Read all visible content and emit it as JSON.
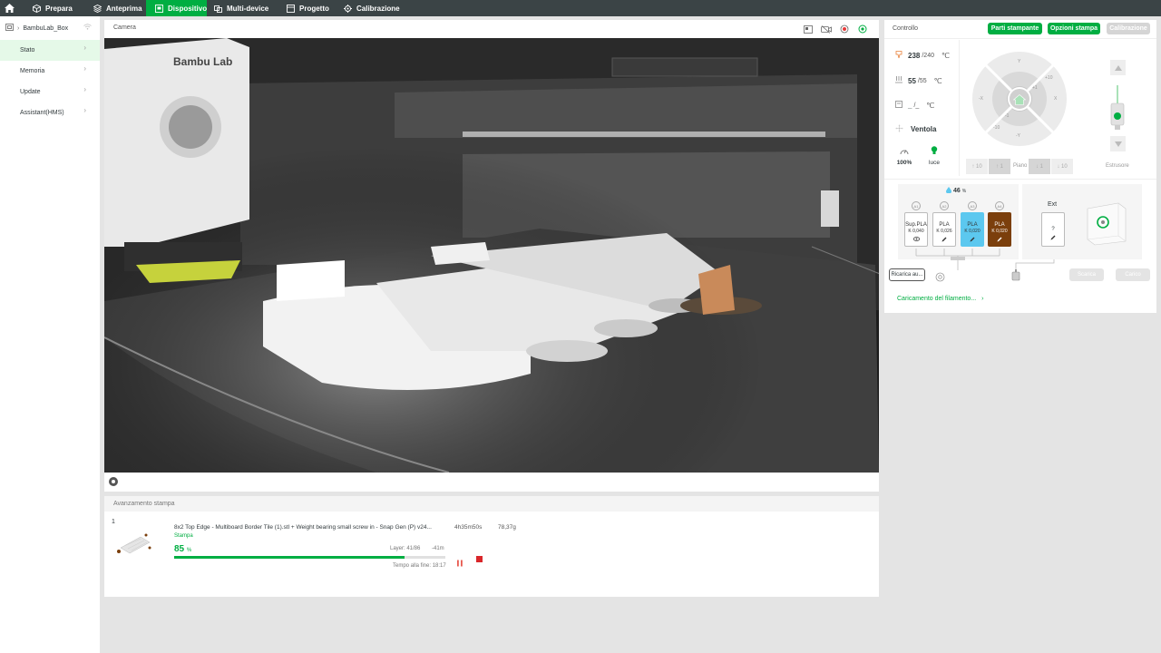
{
  "nav": {
    "tabs": [
      {
        "label": "Prepara",
        "icon": "cube-icon"
      },
      {
        "label": "Anteprima",
        "icon": "layers-icon"
      },
      {
        "label": "Dispositivo",
        "icon": "device-icon"
      },
      {
        "label": "Multi-device",
        "icon": "multi-device-icon"
      },
      {
        "label": "Progetto",
        "icon": "project-icon"
      },
      {
        "label": "Calibrazione",
        "icon": "calibration-icon"
      }
    ],
    "active": "Dispositivo"
  },
  "sidebar": {
    "device_name": "BambuLab_Box",
    "items": [
      {
        "label": "Stato"
      },
      {
        "label": "Memoria"
      },
      {
        "label": "Update"
      },
      {
        "label": "Assistant(HMS)"
      }
    ]
  },
  "camera": {
    "title": "Camera"
  },
  "progress": {
    "title": "Avanzamento stampa",
    "plate_number": "1",
    "file_name": "8x2 Top Edge - Multiboard Border Tile (1).stl + Weight bearing small screw in - Snap Gen  (P) v24...",
    "duration": "4h35m50s",
    "weight": "78,37g",
    "status": "Stampa",
    "percent": "85",
    "percent_unit": "%",
    "layer": "Layer: 41/86",
    "remaining": "-41m",
    "end_time": "Tempo alla fine: 18:17",
    "fraction": 0.85
  },
  "control": {
    "title": "Controllo",
    "btn_parts": "Parti stampante",
    "btn_options": "Opzioni stampa",
    "btn_calibration": "Calibrazione",
    "nozzle": {
      "current": "238",
      "target": "/240",
      "unit": "℃"
    },
    "bed": {
      "current": "55",
      "target": "/55",
      "unit": "℃"
    },
    "chamber": {
      "current": "_",
      "target": "/_",
      "unit": "℃"
    },
    "fan_label": "Ventola",
    "speed_value": "100%",
    "light_label": "luce",
    "jog": {
      "up": "Y",
      "down": "-Y",
      "left": "-X",
      "right": "X",
      "plus10": "+10",
      "plus1": "+1",
      "minus1": "-1",
      "minus10": "-10"
    },
    "bed_buttons": [
      "10",
      "1",
      "1",
      "10"
    ],
    "bed_label": "Piano",
    "extruder_label": "Estrusore"
  },
  "ams": {
    "humidity": "46",
    "humidity_unit": "%",
    "slots": [
      {
        "id": "A1",
        "type": "Sup.PLA",
        "k": "K 0,040",
        "color": "#ffffff",
        "text_color": "#333333"
      },
      {
        "id": "A2",
        "type": "PLA",
        "k": "K 0,026",
        "color": "#ffffff",
        "text_color": "#333333"
      },
      {
        "id": "A3",
        "type": "PLA",
        "k": "K 0,020",
        "color": "#5cc8ef",
        "text_color": "#333333"
      },
      {
        "id": "A4",
        "type": "PLA",
        "k": "K 0,020",
        "color": "#7b3f0c",
        "text_color": "#ffffff"
      }
    ],
    "ext_label": "Ext",
    "ext_slot": "?",
    "reload_label": "Ricarica au...",
    "unload_label": "Scarica",
    "load_label": "Carico",
    "loading_link": "Caricamento del filamento..."
  },
  "colors": {
    "accent": "#00ae42",
    "topbar": "#3b4446",
    "danger": "#e63a3a"
  }
}
